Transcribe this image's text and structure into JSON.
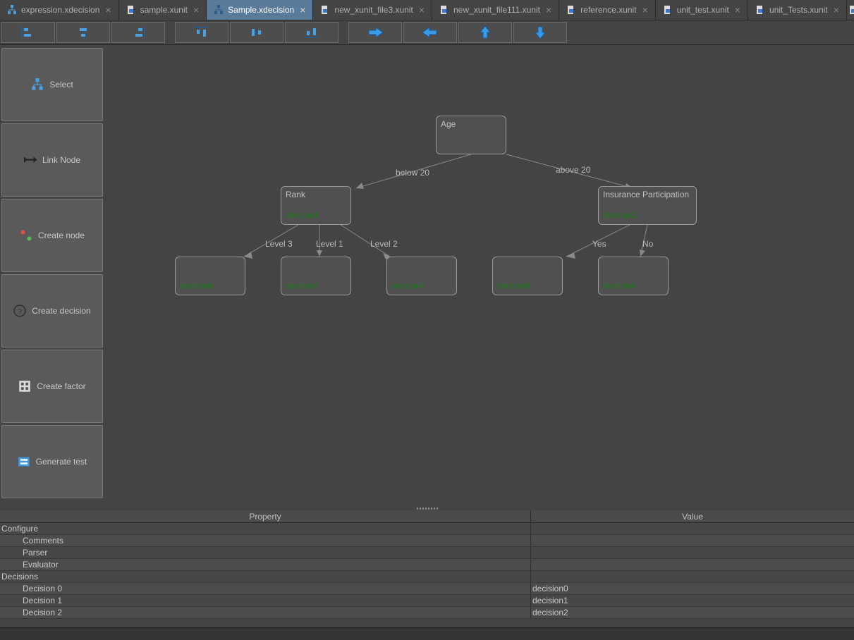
{
  "tabs": [
    {
      "label": "expression.xdecision",
      "icon": "tree"
    },
    {
      "label": "sample.xunit",
      "icon": "xunit"
    },
    {
      "label": "Sample.xdecision",
      "icon": "tree",
      "active": true
    },
    {
      "label": "new_xunit_file3.xunit",
      "icon": "xunit"
    },
    {
      "label": "new_xunit_file111.xunit",
      "icon": "xunit"
    },
    {
      "label": "reference.xunit",
      "icon": "xunit"
    },
    {
      "label": "unit_test.xunit",
      "icon": "xunit"
    },
    {
      "label": "unit_Tests.xunit",
      "icon": "xunit"
    }
  ],
  "palette": {
    "select": "Select",
    "link_node": "Link Node",
    "create_node": "Create node",
    "create_decision": "Create decision",
    "create_factor": "Create factor",
    "generate_test": "Generate test"
  },
  "nodes": {
    "age": {
      "label": "Age"
    },
    "rank": {
      "label": "Rank",
      "dec": "decision1"
    },
    "insurance": {
      "label": "Insurance Participation",
      "dec": "decision2"
    },
    "leaf1": {
      "dec": "decision6"
    },
    "leaf2": {
      "dec": "decision3"
    },
    "leaf3": {
      "dec": "decision4"
    },
    "leaf4": {
      "dec": "decision5"
    },
    "leaf5": {
      "dec": "decision8"
    }
  },
  "edges": {
    "below20": "below 20",
    "above20": "above 20",
    "level3": "Level 3",
    "level1": "Level 1",
    "level2": "Level 2",
    "yes": "Yes",
    "no": "No"
  },
  "grid": {
    "headers": {
      "property": "Property",
      "value": "Value"
    },
    "rows": [
      {
        "p": "Configure",
        "v": "",
        "indent": 0
      },
      {
        "p": "Comments",
        "v": "",
        "indent": 1
      },
      {
        "p": "Parser",
        "v": "",
        "indent": 1
      },
      {
        "p": "Evaluator",
        "v": "",
        "indent": 1
      },
      {
        "p": "Decisions",
        "v": "",
        "indent": 0
      },
      {
        "p": "Decision 0",
        "v": "decision0",
        "indent": 1
      },
      {
        "p": "Decision 1",
        "v": "decision1",
        "indent": 1
      },
      {
        "p": "Decision 2",
        "v": "decision2",
        "indent": 1
      }
    ]
  }
}
